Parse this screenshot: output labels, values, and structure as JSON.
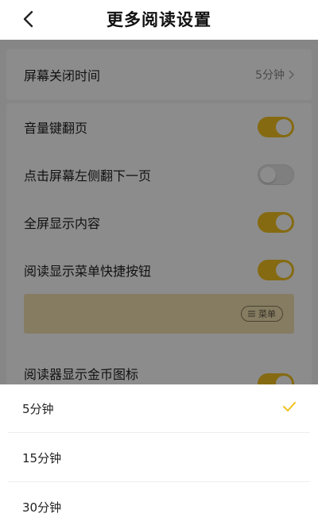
{
  "header": {
    "title": "更多阅读设置"
  },
  "settings": {
    "screen_off": {
      "label": "屏幕关闭时间",
      "value": "5分钟"
    },
    "toggles": [
      {
        "label": "音量键翻页",
        "on": true
      },
      {
        "label": "点击屏幕左侧翻下一页",
        "on": false
      },
      {
        "label": "全屏显示内容",
        "on": true
      },
      {
        "label": "阅读显示菜单快捷按钮",
        "on": true
      }
    ],
    "preview": {
      "menu_chip_label": "菜单"
    },
    "coin_icon": {
      "label": "阅读器显示金币图标",
      "on": true
    }
  },
  "picker": {
    "options": [
      {
        "label": "5分钟",
        "selected": true
      },
      {
        "label": "15分钟",
        "selected": false
      },
      {
        "label": "30分钟",
        "selected": false
      }
    ]
  },
  "colors": {
    "accent": "#f2c21f",
    "preview_bg": "#f3e2b3"
  }
}
